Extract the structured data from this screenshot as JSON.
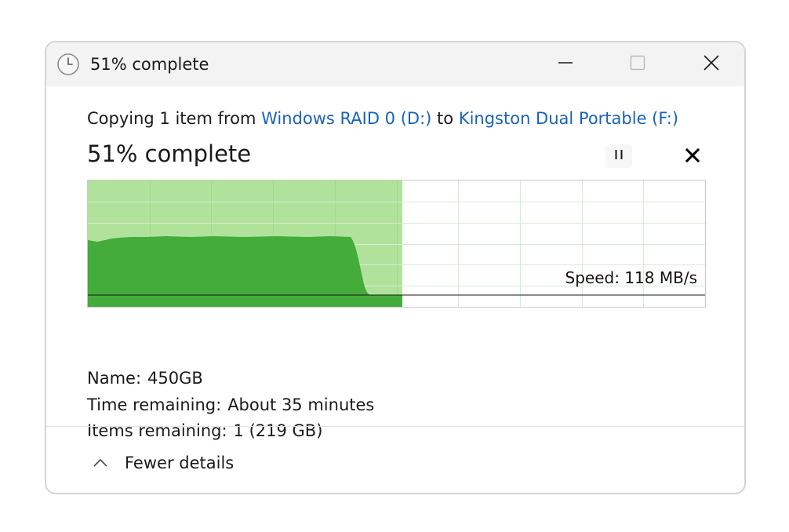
{
  "window": {
    "title": "51% complete",
    "icon": "clock-icon"
  },
  "controls": {
    "minimize_icon": "minimize-icon",
    "maximize_icon": "maximize-icon",
    "close_icon": "close-icon"
  },
  "copy": {
    "prefix": "Copying 1 item from ",
    "source": "Windows RAID 0 (D:)",
    "middle": " to ",
    "destination": "Kingston Dual Portable (F:)",
    "link_color": "#1a63b8"
  },
  "progress": {
    "label": "51% complete",
    "fraction": 0.51,
    "pause_icon": "pause-icon",
    "cancel_icon": "cancel-icon",
    "fill_color": "#b1e29b",
    "speed_area_color": "#43ac3b"
  },
  "speed": {
    "text": "Speed: 118 MB/s"
  },
  "details": {
    "name_label": "Name:",
    "name_value": "450GB",
    "time_label": "Time remaining:",
    "time_value": "About 35 minutes",
    "items_label": "Items remaining:",
    "items_value": "1 (219 GB)"
  },
  "footer": {
    "toggle_label": "Fewer details",
    "toggle_icon": "chevron-up-icon"
  }
}
